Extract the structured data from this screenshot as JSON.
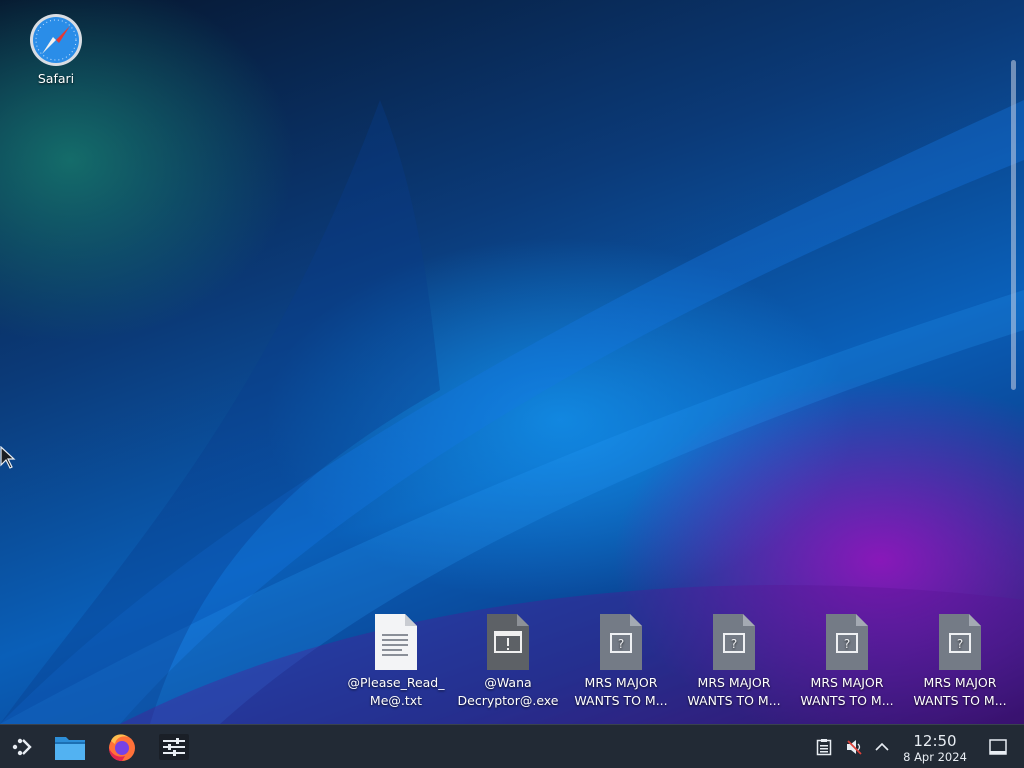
{
  "desktop": {
    "icons": [
      {
        "name": "safari",
        "label": "Safari"
      },
      {
        "name": "please-read-me",
        "label_line1": "@Please_Read_",
        "label_line2": "Me@.txt"
      },
      {
        "name": "wana-decryptor",
        "label_line1": "@Wana",
        "label_line2": "Decryptor@.exe"
      },
      {
        "name": "mrs-major-1",
        "label_line1": "MRS MAJOR",
        "label_line2": "WANTS TO M..."
      },
      {
        "name": "mrs-major-2",
        "label_line1": "MRS MAJOR",
        "label_line2": "WANTS TO M..."
      },
      {
        "name": "mrs-major-3",
        "label_line1": "MRS MAJOR",
        "label_line2": "WANTS TO M..."
      },
      {
        "name": "mrs-major-4",
        "label_line1": "MRS MAJOR",
        "label_line2": "WANTS TO M..."
      }
    ]
  },
  "taskbar": {
    "launchers": [
      "app-launcher-icon",
      "file-manager-icon",
      "firefox-icon",
      "system-settings-icon"
    ],
    "tray": [
      "clipboard-icon",
      "volume-muted-icon",
      "expand-tray-icon"
    ],
    "clock": {
      "time": "12:50",
      "date": "8 Apr 2024"
    },
    "show_desktop": "show-desktop-icon"
  }
}
